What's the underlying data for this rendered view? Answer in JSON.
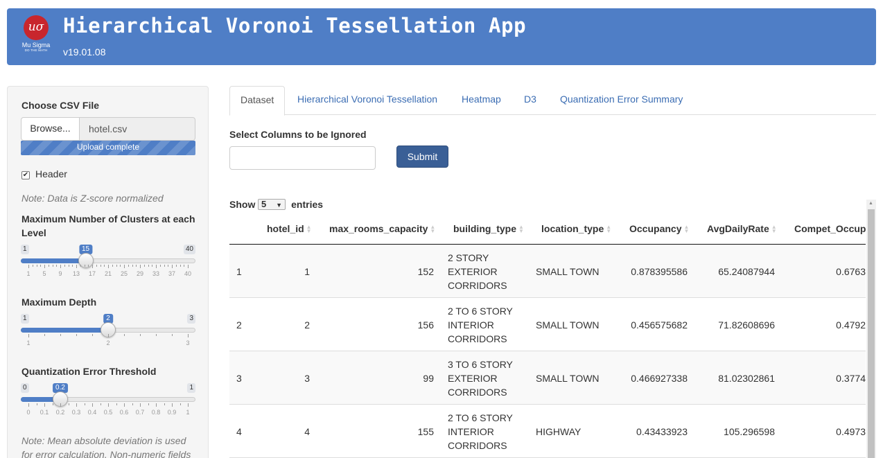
{
  "header": {
    "logo_symbol": "uσ",
    "logo_name": "Mu Sigma",
    "logo_tagline": "DO THE MATH",
    "title": "Hierarchical Voronoi Tessellation App",
    "version": "v19.01.08"
  },
  "sidebar": {
    "file_label": "Choose CSV File",
    "browse_label": "Browse...",
    "file_name": "hotel.csv",
    "upload_status": "Upload complete",
    "upload_progress": 1.0,
    "header_checkbox": {
      "label": "Header",
      "checked": true
    },
    "note_normalized": "Note: Data is Z-score normalized",
    "clusters_label": "Maximum Number of Clusters at each Level",
    "clusters_slider": {
      "min": "1",
      "max": "40",
      "value": "15",
      "ticks": [
        "1",
        "5",
        "9",
        "13",
        "17",
        "21",
        "25",
        "29",
        "33",
        "37",
        "40"
      ]
    },
    "depth_label": "Maximum Depth",
    "depth_slider": {
      "min": "1",
      "max": "3",
      "value": "2",
      "ticks": [
        "1",
        "2",
        "3"
      ]
    },
    "qe_label": "Quantization Error Threshold",
    "qe_slider": {
      "min": "0",
      "max": "1",
      "value": "0.2",
      "ticks": [
        "0",
        "0.1",
        "0.2",
        "0.3",
        "0.4",
        "0.5",
        "0.6",
        "0.7",
        "0.8",
        "0.9",
        "1"
      ]
    },
    "note_mad": "Note: Mean absolute deviation is used for error calculation. Non-numeric fields"
  },
  "tabs": [
    "Dataset",
    "Hierarchical Voronoi Tessellation",
    "Heatmap",
    "D3",
    "Quantization Error Summary"
  ],
  "active_tab": "Dataset",
  "ignore": {
    "label": "Select Columns to be Ignored",
    "value": "",
    "submit_label": "Submit"
  },
  "table": {
    "show_label": "Show",
    "entries_value": "5",
    "entries_label": "entries",
    "columns": [
      "",
      "hotel_id",
      "max_rooms_capacity",
      "building_type",
      "location_type",
      "Occupancy",
      "AvgDailyRate",
      "Compet_Occup"
    ],
    "rows": [
      [
        "1",
        "1",
        "152",
        "2 STORY EXTERIOR CORRIDORS",
        "SMALL TOWN",
        "0.878395586",
        "65.24087944",
        "0.6763"
      ],
      [
        "2",
        "2",
        "156",
        "2 TO 6 STORY INTERIOR CORRIDORS",
        "SMALL TOWN",
        "0.456575682",
        "71.82608696",
        "0.4792"
      ],
      [
        "3",
        "3",
        "99",
        "3 TO 6 STORY EXTERIOR CORRIDORS",
        "SMALL TOWN",
        "0.466927338",
        "81.02302861",
        "0.3774"
      ],
      [
        "4",
        "4",
        "155",
        "2 TO 6 STORY INTERIOR CORRIDORS",
        "HIGHWAY",
        "0.43433923",
        "105.296598",
        "0.4973"
      ]
    ]
  },
  "colors": {
    "header_bg": "#4f7ec6",
    "accent": "#4f7ec6",
    "submit_bg": "#3a5f96",
    "link": "#3b6db3"
  }
}
